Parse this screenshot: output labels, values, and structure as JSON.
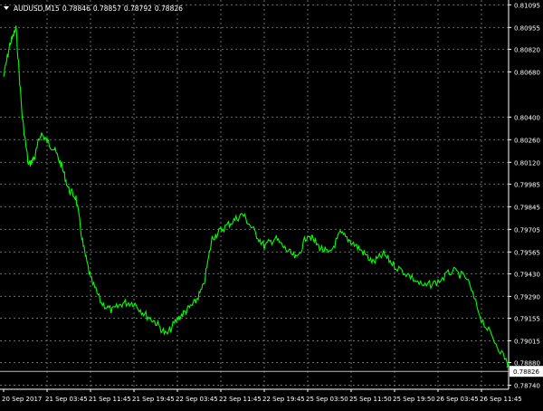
{
  "header": {
    "symbol": "AUDUSD,M15",
    "open": "0.78846",
    "high": "0.78857",
    "low": "0.78792",
    "close": "0.78826",
    "menu_icon": "triangle-down-icon"
  },
  "colors": {
    "background": "#000000",
    "grid": "#6b6b6b",
    "axis": "#ffffff",
    "line": "#00ff00",
    "price_tag_bg": "#ffffff",
    "price_tag_text": "#000000"
  },
  "chart_data": {
    "type": "line",
    "title": "AUDUSD,M15",
    "xlabel": "",
    "ylabel": "",
    "grid": true,
    "ylim": [
      0.78715,
      0.81125
    ],
    "y_ticks": [
      "0.81095",
      "0.80955",
      "0.80820",
      "0.80680",
      "0.80400",
      "0.80260",
      "0.80120",
      "0.79985",
      "0.79845",
      "0.79705",
      "0.79565",
      "0.79430",
      "0.79290",
      "0.79155",
      "0.79015",
      "0.78880",
      "0.78740"
    ],
    "x_ticks": [
      "20 Sep 2017",
      "21 Sep 03:45",
      "21 Sep 11:45",
      "21 Sep 19:45",
      "22 Sep 03:45",
      "22 Sep 11:45",
      "22 Sep 19:45",
      "25 Sep 03:50",
      "25 Sep 11:50",
      "25 Sep 19:50",
      "26 Sep 03:45",
      "26 Sep 11:45"
    ],
    "current_price": "0.78826",
    "series": [
      {
        "x": [
          "20 Sep 2017",
          "20 Sep 2017",
          "20 Sep 2017",
          "20 Sep 2017",
          "20 Sep 2017",
          "20 Sep 2017",
          "20 Sep 2017",
          "21 Sep 03:45",
          "21 Sep 03:45",
          "21 Sep 03:45",
          "21 Sep 03:45",
          "21 Sep 03:45",
          "21 Sep 03:45",
          "21 Sep 11:45",
          "21 Sep 11:45",
          "21 Sep 11:45",
          "21 Sep 11:45",
          "21 Sep 19:45",
          "21 Sep 19:45",
          "21 Sep 19:45",
          "21 Sep 19:45",
          "22 Sep 03:45",
          "22 Sep 03:45",
          "22 Sep 03:45",
          "22 Sep 03:45",
          "22 Sep 03:45",
          "22 Sep 11:45",
          "22 Sep 11:45",
          "22 Sep 11:45",
          "22 Sep 11:45",
          "22 Sep 19:45",
          "22 Sep 19:45",
          "22 Sep 19:45",
          "22 Sep 19:45",
          "25 Sep 03:50",
          "25 Sep 03:50",
          "25 Sep 03:50",
          "25 Sep 03:50",
          "25 Sep 11:50",
          "25 Sep 11:50",
          "25 Sep 11:50",
          "25 Sep 11:50",
          "25 Sep 19:50",
          "25 Sep 19:50",
          "25 Sep 19:50",
          "26 Sep 03:45",
          "26 Sep 03:45",
          "26 Sep 03:45",
          "26 Sep 11:45",
          "26 Sep 11:45",
          "26 Sep 11:45"
        ],
        "values": [
          0.8065,
          0.8085,
          0.8095,
          0.804,
          0.801,
          0.8015,
          0.803,
          0.8025,
          0.802,
          0.801,
          0.7995,
          0.799,
          0.796,
          0.794,
          0.7925,
          0.792,
          0.7925,
          0.7925,
          0.7918,
          0.7913,
          0.7905,
          0.7915,
          0.792,
          0.7925,
          0.7935,
          0.7965,
          0.797,
          0.7975,
          0.798,
          0.797,
          0.796,
          0.7965,
          0.7958,
          0.7952,
          0.7968,
          0.796,
          0.7955,
          0.7968,
          0.7963,
          0.7957,
          0.795,
          0.7955,
          0.7948,
          0.7942,
          0.7935,
          0.7938,
          0.7945,
          0.794,
          0.7915,
          0.79,
          0.7885
        ]
      }
    ]
  }
}
